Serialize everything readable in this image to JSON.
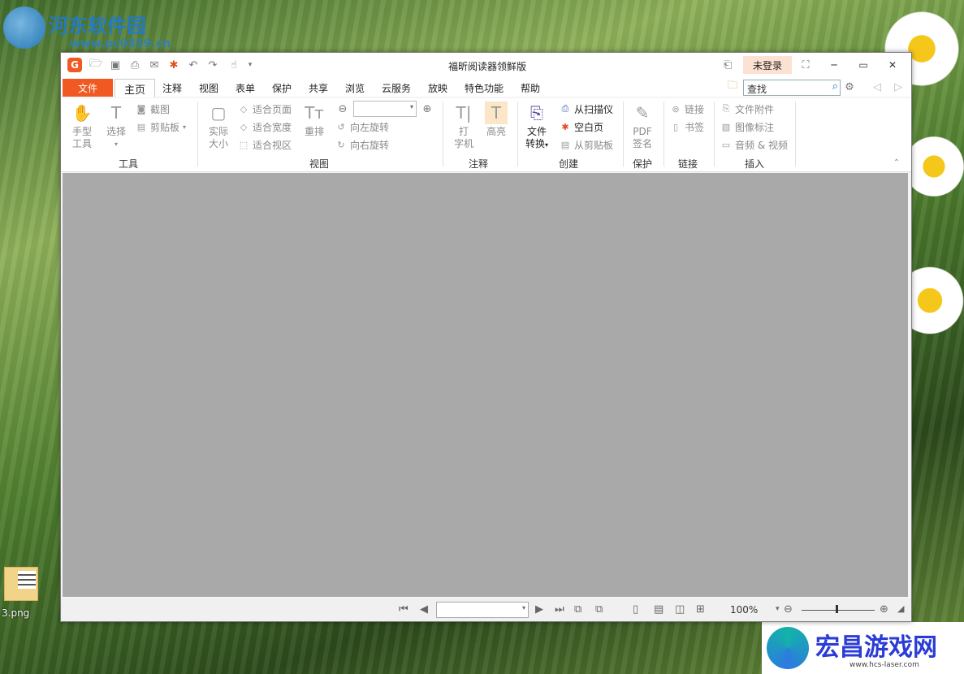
{
  "desktop": {
    "watermark_top": {
      "title": "河东软件园",
      "url": "www.pc0359.cn"
    },
    "icon": {
      "label": "3.png"
    },
    "watermark_bottom": {
      "title": "宏昌游戏网",
      "url": "www.hcs-laser.com"
    }
  },
  "window": {
    "title": "福昕阅读器领鲜版",
    "login_label": "未登录"
  },
  "menu": {
    "file": "文件",
    "tabs": [
      "主页",
      "注释",
      "视图",
      "表单",
      "保护",
      "共享",
      "浏览",
      "云服务",
      "放映",
      "特色功能",
      "帮助"
    ],
    "search_placeholder": "查找"
  },
  "ribbon": {
    "tools": {
      "group": "工具",
      "hand": [
        "手型",
        "工具"
      ],
      "select": "选择",
      "screenshot": "截图",
      "clipboard": "剪贴板"
    },
    "view": {
      "group": "视图",
      "actual_size": [
        "实际",
        "大小"
      ],
      "fit_page": "适合页面",
      "fit_width": "适合宽度",
      "fit_visible": "适合视区",
      "reflow": "重排",
      "rotate_left": "向左旋转",
      "rotate_right": "向右旋转"
    },
    "comment": {
      "group": "注释",
      "typewriter": [
        "打",
        "字机"
      ],
      "highlight": "高亮"
    },
    "create": {
      "group": "创建",
      "convert": [
        "文件",
        "转换"
      ],
      "from_scanner": "从扫描仪",
      "blank_page": "空白页",
      "from_clipboard": "从剪贴板"
    },
    "protect": {
      "group": "保护",
      "pdf_sign": [
        "PDF",
        "签名",
        "保护"
      ]
    },
    "links": {
      "group": "链接",
      "link": "链接",
      "bookmark": "书签"
    },
    "insert": {
      "group": "插入",
      "attachment": "文件附件",
      "image_annotation": "图像标注",
      "audio_video": "音频 & 视频"
    }
  },
  "statusbar": {
    "zoom": "100%"
  }
}
